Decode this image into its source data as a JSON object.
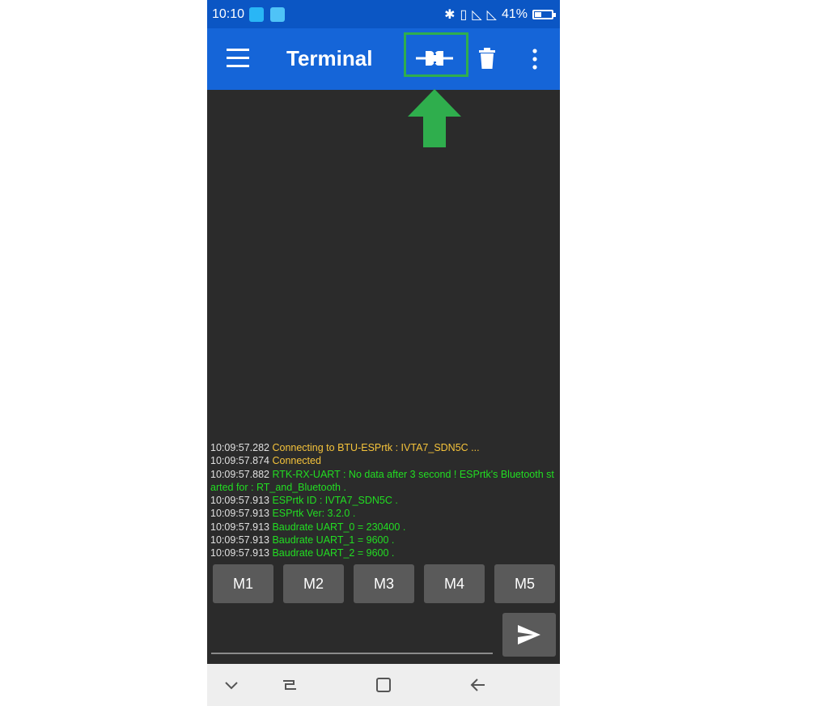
{
  "status_bar": {
    "time": "10:10",
    "battery": "41%",
    "battery_level": 0.41,
    "icons": [
      "screenshot-icon",
      "weather-icon",
      "bluetooth-icon",
      "vibrate-icon",
      "signal-icon",
      "signal-icon",
      "battery-icon"
    ]
  },
  "app_bar": {
    "title": "Terminal",
    "actions": [
      "menu-icon",
      "connect-plug-icon",
      "trash-icon",
      "more-vert-icon"
    ]
  },
  "annotation": {
    "color": "#2fae4d",
    "shape": "up-arrow"
  },
  "log": [
    {
      "ts": "10:09:57.282",
      "text": " Connecting to BTU-ESPrtk : IVTA7_SDN5C ...",
      "color": "yellow"
    },
    {
      "ts": "10:09:57.874",
      "text": " Connected",
      "color": "yellow"
    },
    {
      "ts": "10:09:57.882",
      "text": " RTK-RX-UART : No data after 3 second ! ESPrtk's Bluetooth started for : RT_and_Bluetooth .",
      "color": "green"
    },
    {
      "ts": "10:09:57.913",
      "text": " ESPrtk ID : IVTA7_SDN5C .",
      "color": "green"
    },
    {
      "ts": "10:09:57.913",
      "text": " ESPrtk Ver: 3.2.0 .",
      "color": "green"
    },
    {
      "ts": "10:09:57.913",
      "text": " Baudrate UART_0 = 230400 .",
      "color": "green"
    },
    {
      "ts": "10:09:57.913",
      "text": " Baudrate UART_1 = 9600 .",
      "color": "green"
    },
    {
      "ts": "10:09:57.913",
      "text": " Baudrate UART_2 = 9600 .",
      "color": "green"
    }
  ],
  "macros": [
    "M1",
    "M2",
    "M3",
    "M4",
    "M5"
  ],
  "input": {
    "value": "",
    "placeholder": ""
  },
  "nav_bar": [
    "chevron-down-icon",
    "recents-icon",
    "home-icon",
    "back-icon"
  ]
}
